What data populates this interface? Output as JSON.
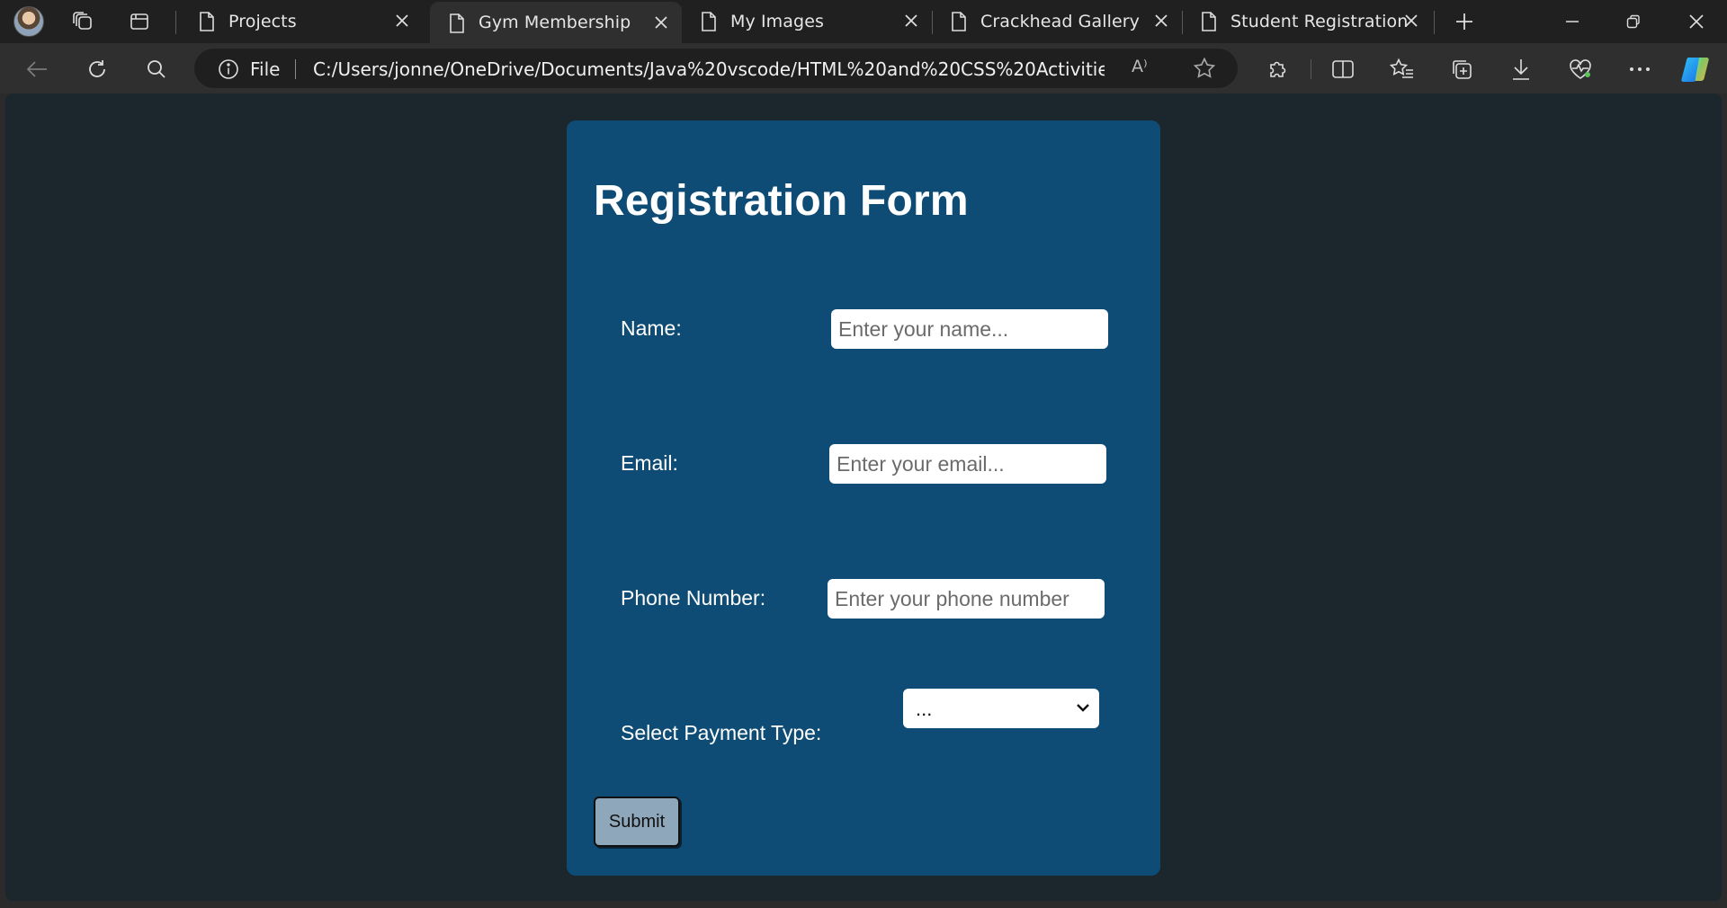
{
  "browser": {
    "tabs": [
      {
        "title": "Projects"
      },
      {
        "title": "Gym Membership"
      },
      {
        "title": "My Images"
      },
      {
        "title": "Crackhead Gallery"
      },
      {
        "title": "Student Registration"
      }
    ],
    "active_tab_index": 1,
    "address": {
      "scheme_label": "File",
      "url": "C:/Users/jonne/OneDrive/Documents/Java%20vscode/HTML%20and%20CSS%20Activities/proj..."
    },
    "read_aloud_label": "A⁾"
  },
  "form": {
    "title": "Registration Form",
    "fields": {
      "name": {
        "label": "Name:",
        "placeholder": "Enter your name..."
      },
      "email": {
        "label": "Email:",
        "placeholder": "Enter your email..."
      },
      "phone": {
        "label": "Phone Number:",
        "placeholder": "Enter your phone number"
      },
      "payment": {
        "label": "Select Payment Type:",
        "selected": "..."
      }
    },
    "submit_label": "Submit"
  },
  "colors": {
    "page_background": "#1b262d",
    "card_background": "#0f4c75",
    "submit_background": "#8fa7bb"
  }
}
